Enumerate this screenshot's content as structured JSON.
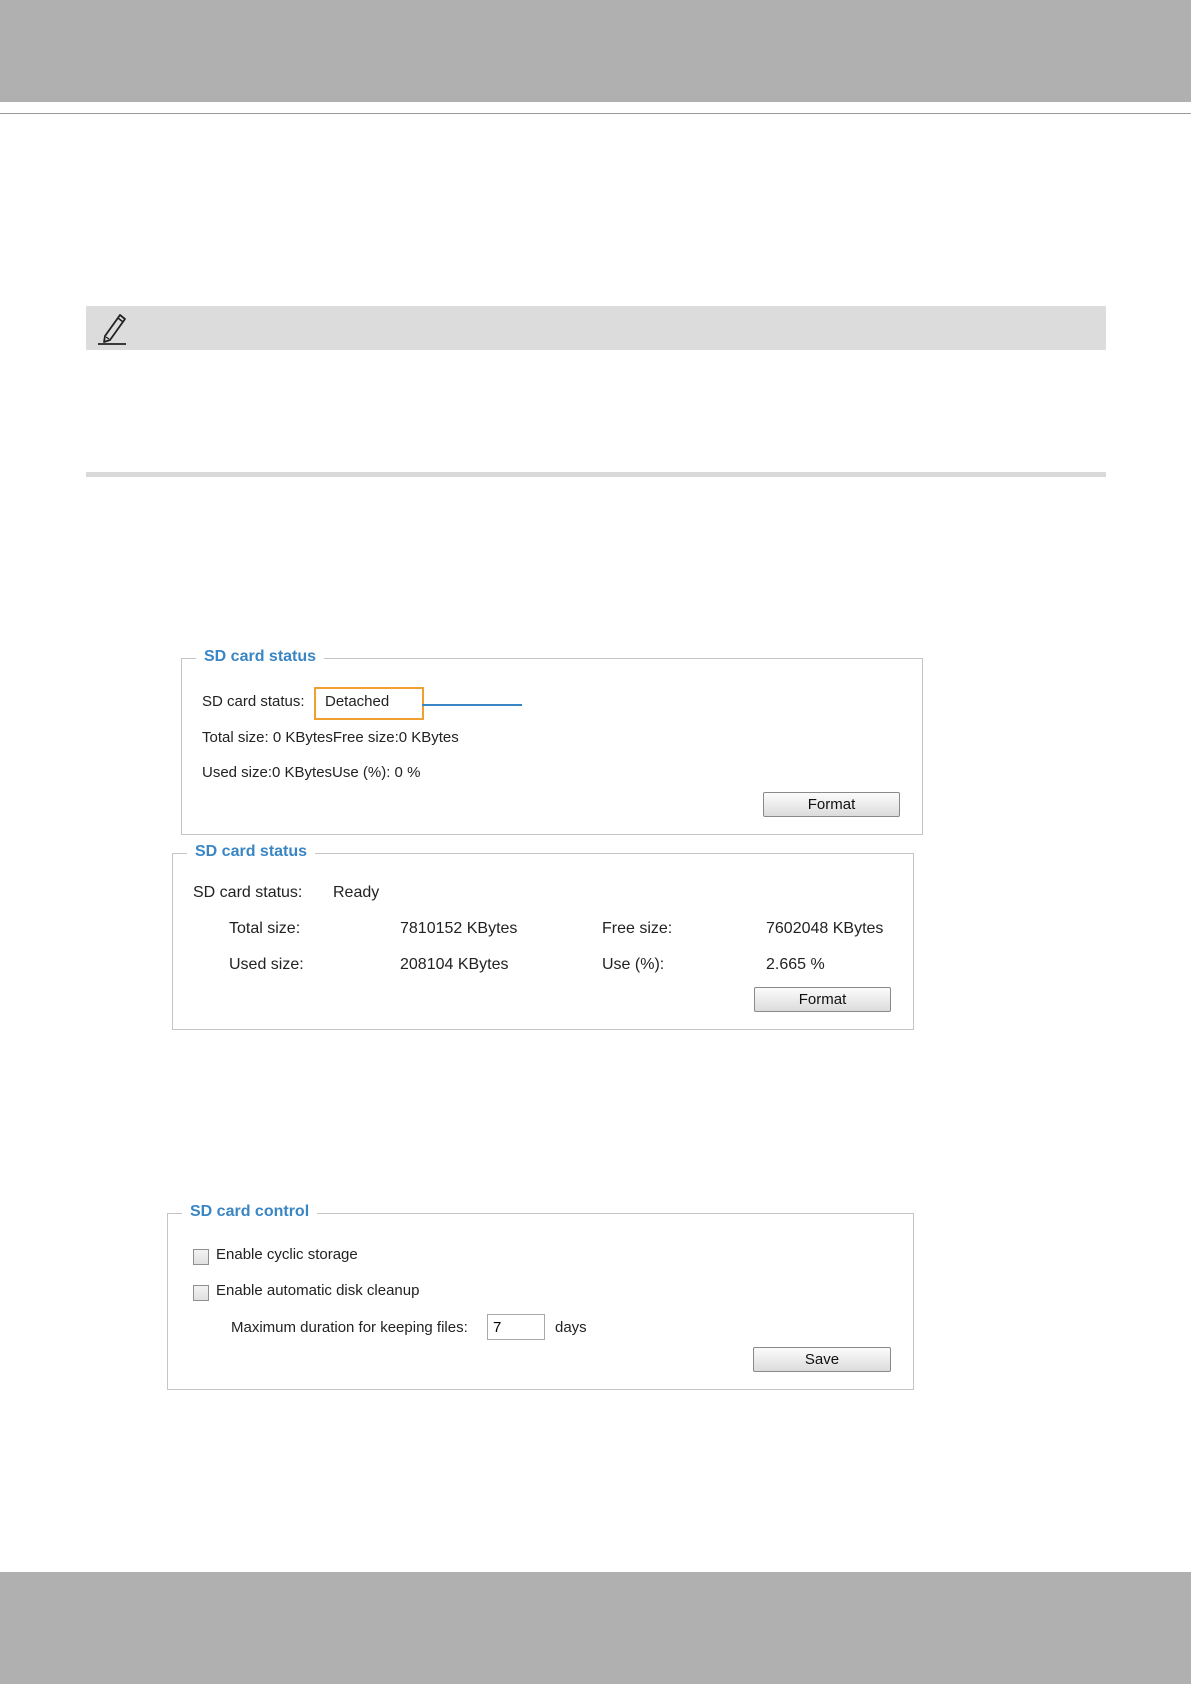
{
  "panel_detached": {
    "legend": "SD card status",
    "status_label": "SD card status:",
    "status_value": "Detached",
    "total_line": "Total size: 0  KBytesFree size:0  KBytes",
    "used_line": "Used size:0  KBytesUse (%):  0 %",
    "format_label": "Format"
  },
  "panel_ready": {
    "legend": "SD card status",
    "status_label": "SD card status:",
    "status_value": "Ready",
    "total_size_label": "Total size:",
    "total_size_value": "7810152  KBytes",
    "free_size_label": "Free size:",
    "free_size_value": "7602048  KBytes",
    "used_size_label": "Used size:",
    "used_size_value": "208104  KBytes",
    "use_pct_label": "Use (%):",
    "use_pct_value": "2.665 %",
    "format_label": "Format"
  },
  "panel_control": {
    "legend": "SD card control",
    "cyclic_label": "Enable cyclic storage",
    "cleanup_label": "Enable automatic disk cleanup",
    "max_duration_label": "Maximum duration for keeping files:",
    "days_value": "7",
    "days_unit": "days",
    "save_label": "Save"
  },
  "colors": {
    "legend_blue": "#3a86c4",
    "highlight_orange": "#f0a030",
    "band_gray": "#b0b0b0"
  },
  "icons": {
    "note": "pencil-icon"
  }
}
